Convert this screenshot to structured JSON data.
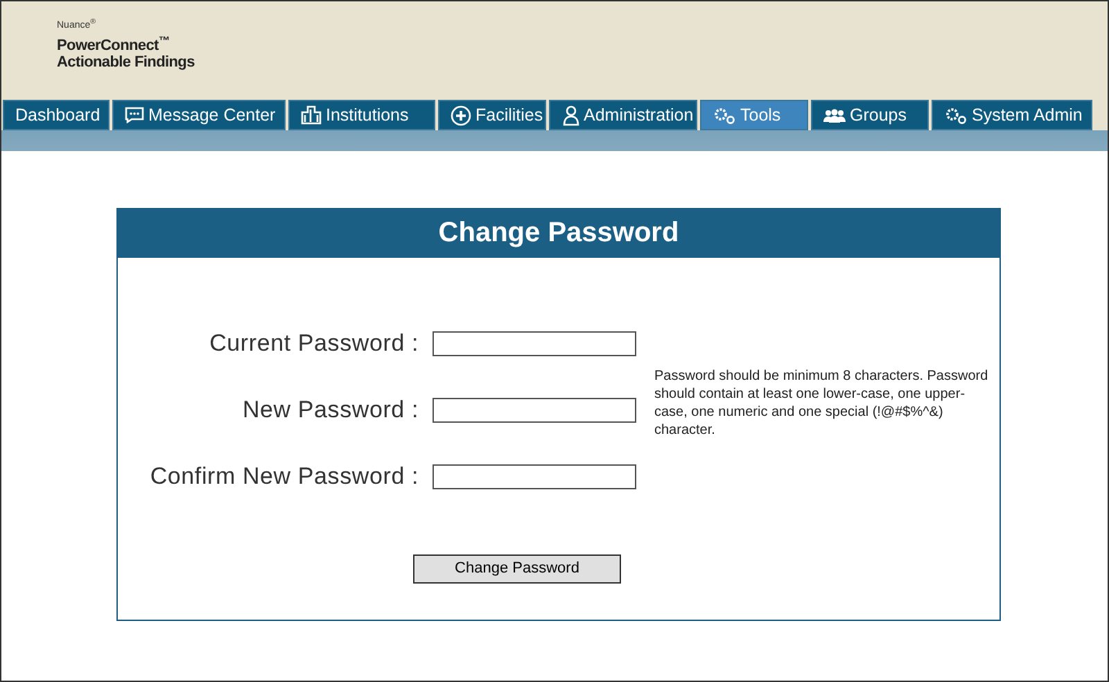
{
  "brand": {
    "company": "Nuance$^{®}$",
    "product": "PowerConnect$^{™}$",
    "subtitle": "Actionable Findings"
  },
  "tabs": [
    {
      "label": "Dashboard",
      "kind": "none",
      "selected": false
    },
    {
      "label": "Message Center",
      "kind": "chat",
      "selected": false
    },
    {
      "label": "Institutions",
      "kind": "building",
      "selected": false
    },
    {
      "label": "Facilities",
      "kind": "plus",
      "selected": false
    },
    {
      "label": "Administration",
      "kind": "person",
      "selected": false
    },
    {
      "label": "Tools",
      "kind": "gears",
      "selected": true
    },
    {
      "label": "Groups",
      "kind": "people",
      "selected": false
    },
    {
      "label": "System Admin",
      "kind": "gears",
      "selected": false
    }
  ],
  "form": {
    "title": "Change Password",
    "fields": [
      {
        "label": "Current Password :"
      },
      {
        "label": "New Password :"
      },
      {
        "label": "Confirm New Password :"
      }
    ],
    "hint": "Password should be minimum 8 characters. Password should contain at least one lower-case, one upper-case, one numeric and one special (!@#$%^&) character.",
    "button": "Change Password"
  }
}
